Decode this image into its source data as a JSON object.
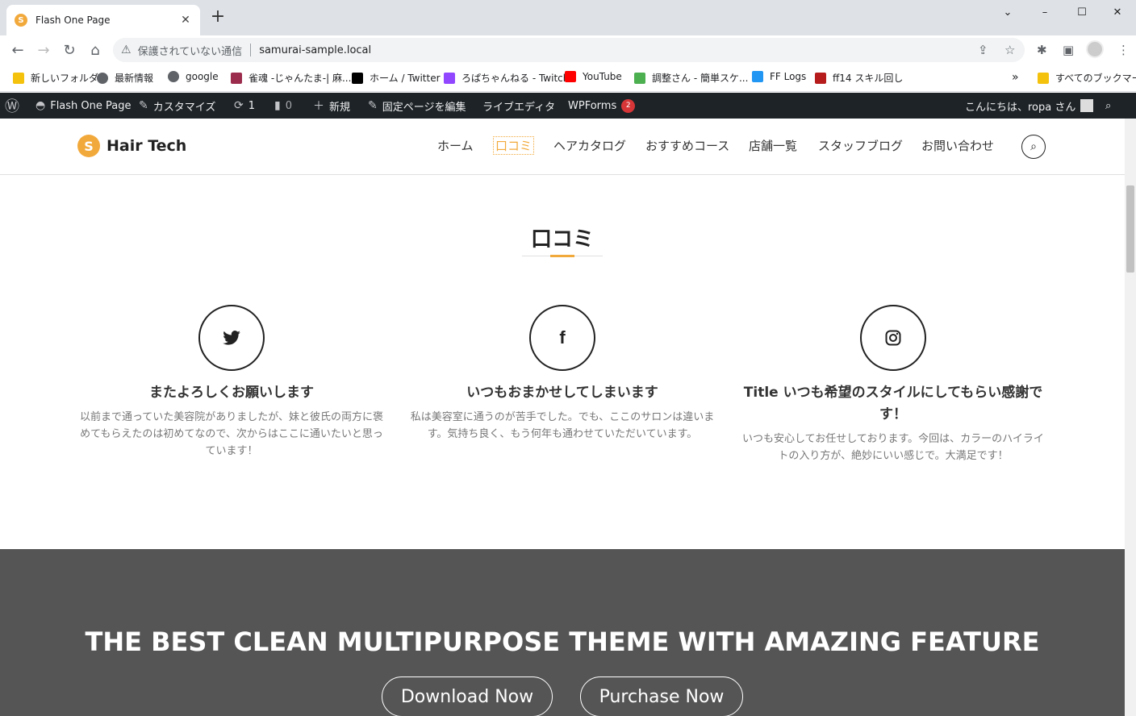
{
  "browser": {
    "tab_title": "Flash One Page",
    "tab_favicon_letter": "S",
    "new_tab": "+",
    "insecure_label": "保護されていない通信",
    "url": "samurai-sample.local",
    "window_min": "–",
    "window_max": "☐",
    "window_close": "✕",
    "chevron": "⌄",
    "bookmarks": [
      {
        "label": "新しいフォルダ",
        "icon": "folder-icon",
        "color": "#f4c20d"
      },
      {
        "label": "最新情報",
        "icon": "globe-icon",
        "color": "#5f6368"
      },
      {
        "label": "google",
        "icon": "globe-icon",
        "color": "#5f6368"
      },
      {
        "label": "雀魂 -じゃんたま-| 麻...",
        "icon": "app-icon",
        "color": "#9c2c4d"
      },
      {
        "label": "ホーム / Twitter",
        "icon": "x-icon",
        "color": "#000000"
      },
      {
        "label": "ろぱちゃんねる - Twitch",
        "icon": "twitch-icon",
        "color": "#9146ff"
      },
      {
        "label": "YouTube",
        "icon": "youtube-icon",
        "color": "#ff0000"
      },
      {
        "label": "調整さん - 簡単スケ...",
        "icon": "calendar-icon",
        "color": "#4caf50"
      },
      {
        "label": "FF Logs",
        "icon": "fflogs-icon",
        "color": "#2196f3"
      },
      {
        "label": "ff14 スキル回し",
        "icon": "game-icon",
        "color": "#b71c1c"
      }
    ],
    "overflow": "»",
    "all_bookmarks": "すべてのブックマーク"
  },
  "wp_admin": {
    "site_name": "Flash One Page",
    "customize": "カスタマイズ",
    "updates_count": "1",
    "comments_count": "0",
    "new_label": "新規",
    "edit_page": "固定ページを編集",
    "live_editor": "ライブエディタ",
    "wpforms": "WPForms",
    "wpforms_badge": "2",
    "greeting": "こんにちは、ropa さん"
  },
  "site": {
    "brand": "Hair Tech",
    "logo_letter": "S",
    "menu": [
      "ホーム",
      "口コミ",
      "ヘアカタログ",
      "おすすめコース",
      "店舗一覧",
      "スタッフブログ",
      "お問い合わせ"
    ],
    "active_menu": "口コミ",
    "accent": "#f2a93b"
  },
  "reviews": {
    "title": "口コミ",
    "cards": [
      {
        "icon": "twitter-icon",
        "glyph": "🐦",
        "title": "またよろしくお願いします",
        "text": "以前まで通っていた美容院がありましたが、妹と彼氏の両方に褒めてもらえたのは初めてなので、次からはここに通いたいと思っています！"
      },
      {
        "icon": "facebook-icon",
        "glyph": "f",
        "title": "いつもおまかせしてしまいます",
        "text": "私は美容室に通うのが苦手でした。でも、ここのサロンは違います。気持ち良く、もう何年も通わせていただいています。"
      },
      {
        "icon": "instagram-icon",
        "glyph": "◎",
        "title": "Title いつも希望のスタイルにしてもらい感謝です！",
        "text": "いつも安心してお任せしております。今回は、カラーのハイライトの入り方が、絶妙にいい感じで。大満足です！"
      }
    ]
  },
  "cta": {
    "title": "THE BEST CLEAN MULTIPURPOSE THEME WITH AMAZING FEATURE",
    "download": "Download Now",
    "purchase": "Purchase Now",
    "bg_color": "#555555"
  }
}
